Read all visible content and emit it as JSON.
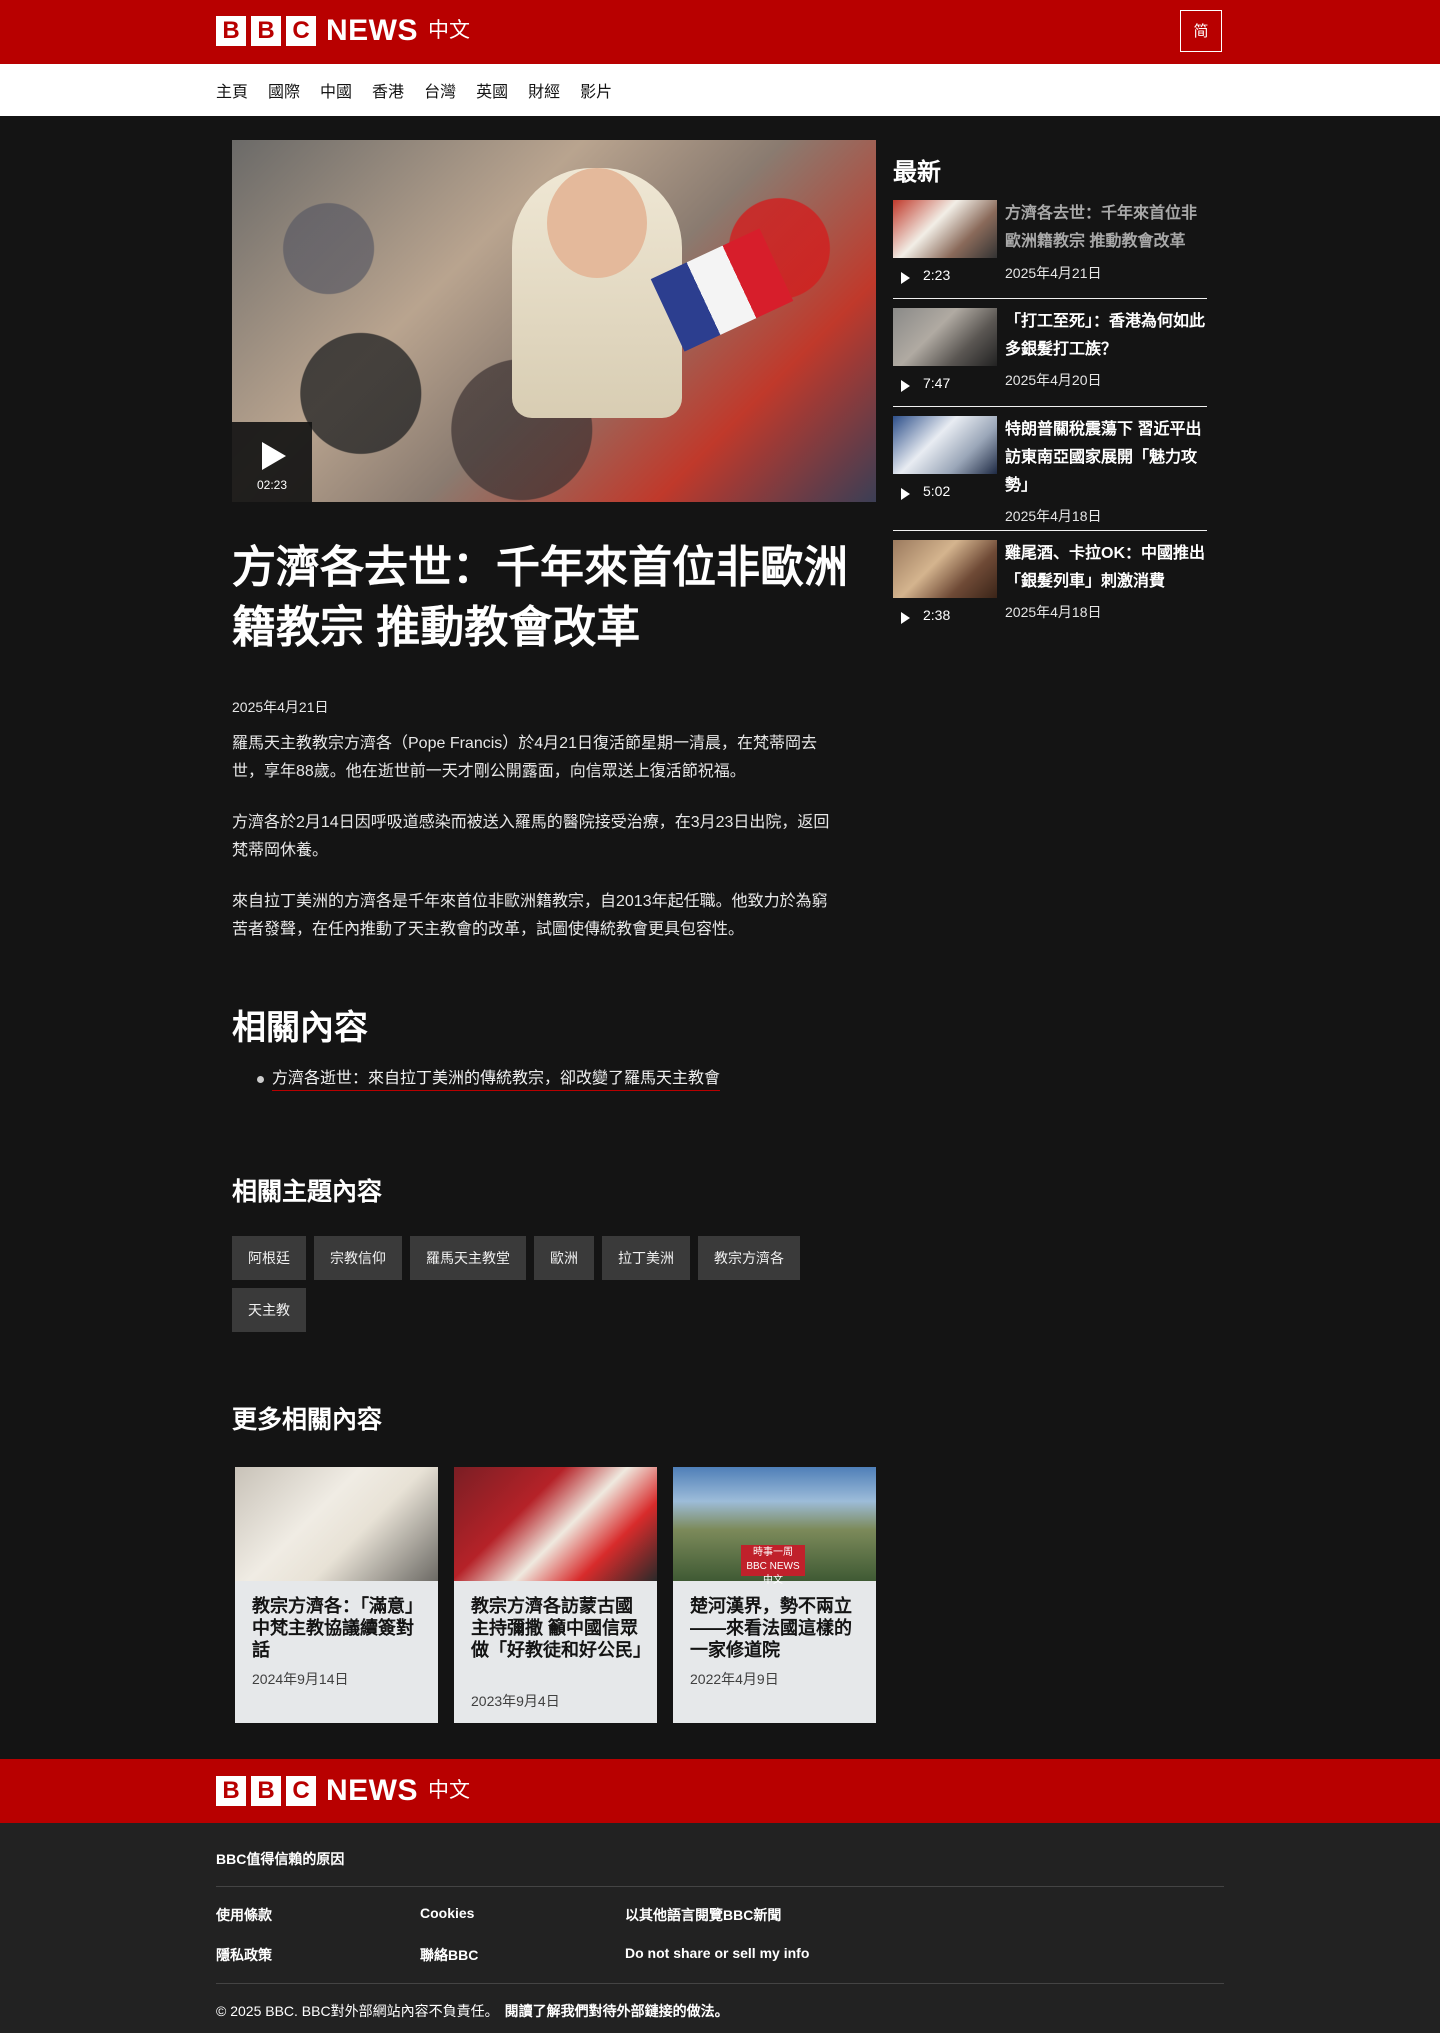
{
  "header": {
    "bbc_letters": [
      "B",
      "B",
      "C"
    ],
    "news": "NEWS",
    "lang": "中文",
    "script_toggle": "简"
  },
  "nav": [
    "主頁",
    "國際",
    "中國",
    "香港",
    "台灣",
    "英國",
    "財經",
    "影片"
  ],
  "hero": {
    "duration": "02:23"
  },
  "article": {
    "headline": "方濟各去世：千年來首位非歐洲籍教宗 推動教會改革",
    "date": "2025年4月21日",
    "paragraphs": [
      "羅馬天主教教宗方濟各（Pope Francis）於4月21日復活節星期一清晨，在梵蒂岡去世，享年88歲。他在逝世前一天才剛公開露面，向信眾送上復活節祝福。",
      "方濟各於2月14日因呼吸道感染而被送入羅馬的醫院接受治療，在3月23日出院，返回梵蒂岡休養。",
      "來自拉丁美洲的方濟各是千年來首位非歐洲籍教宗，自2013年起任職。他致力於為窮苦者發聲，在任內推動了天主教會的改革，試圖使傳統教會更具包容性。"
    ]
  },
  "related": {
    "heading": "相關內容",
    "items": [
      "方濟各逝世：來自拉丁美洲的傳統教宗，卻改變了羅馬天主教會"
    ]
  },
  "topics": {
    "heading": "相關主題內容",
    "tags": [
      "阿根廷",
      "宗教信仰",
      "羅馬天主教堂",
      "歐洲",
      "拉丁美洲",
      "教宗方濟各",
      "天主教"
    ]
  },
  "more": {
    "heading": "更多相關內容",
    "cards": [
      {
        "title": "教宗方濟各：「滿意」中梵主教協議續簽對話",
        "date": "2024年9月14日"
      },
      {
        "title": "教宗方濟各訪蒙古國主持彌撒 籲中國信眾做「好教徒和好公民」",
        "date": "2023年9月4日"
      },
      {
        "title": "楚河漢界，勢不兩立——來看法國這樣的一家修道院",
        "date": "2022年4月9日",
        "badge_line1": "時事一周",
        "badge_line2": "BBC NEWS 中文"
      }
    ]
  },
  "sidebar": {
    "heading": "最新",
    "items": [
      {
        "title": "方濟各去世：千年來首位非歐洲籍教宗 推動教會改革",
        "duration": "2:23",
        "date": "2025年4月21日"
      },
      {
        "title": "「打工至死」：香港為何如此多銀髮打工族？",
        "duration": "7:47",
        "date": "2025年4月20日"
      },
      {
        "title": "特朗普關稅震蕩下 習近平出訪東南亞國家展開「魅力攻勢」",
        "duration": "5:02",
        "date": "2025年4月18日"
      },
      {
        "title": "雞尾酒、卡拉OK：中國推出「銀髮列車」刺激消費",
        "duration": "2:38",
        "date": "2025年4月18日"
      }
    ]
  },
  "footer": {
    "why": "BBC值得信賴的原因",
    "links": {
      "terms": "使用條款",
      "cookies": "Cookies",
      "other_lang": "以其他語言閱覽BBC新聞",
      "privacy": "隱私政策",
      "contact": "聯絡BBC",
      "dns": "Do not share or sell my info"
    },
    "copyright": "© 2025 BBC. BBC對外部網站內容不負責任。",
    "external_link": "閱讀了解我們對待外部鏈接的做法。"
  }
}
